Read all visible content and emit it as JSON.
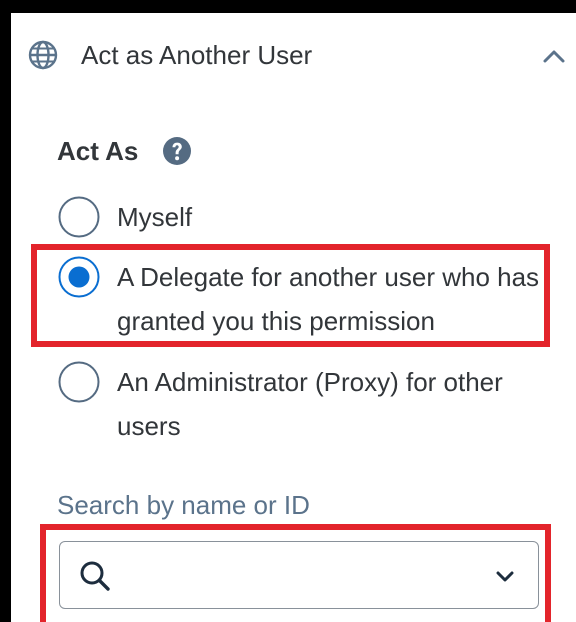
{
  "header": {
    "title": "Act as Another User",
    "icon": "globe-icon",
    "toggle_icon": "chevron-up-icon"
  },
  "act_as": {
    "label": "Act As",
    "help_icon": "question-circle-icon",
    "options": [
      {
        "label": "Myself",
        "selected": false
      },
      {
        "label": "A Delegate for another user who has granted you this permission",
        "selected": true
      },
      {
        "label": "An Administrator (Proxy) for other users",
        "selected": false
      }
    ]
  },
  "search": {
    "label": "Search by name or ID",
    "value": "",
    "placeholder": "",
    "icon": "search-icon",
    "dropdown_icon": "chevron-down-icon"
  },
  "colors": {
    "text": "#32363a",
    "accent": "#0a6ed1",
    "label_muted": "#5b738b",
    "highlight": "#e3242b"
  }
}
